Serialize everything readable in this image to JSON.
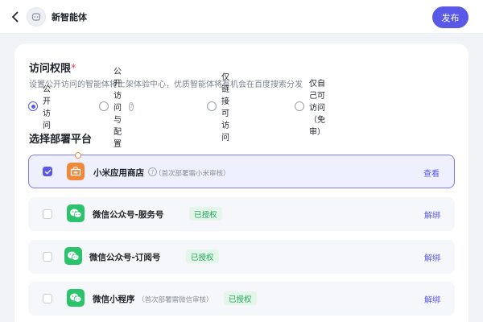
{
  "header": {
    "agent_name": "新智能体",
    "publish_label": "发布"
  },
  "access": {
    "title": "访问权限",
    "required_mark": "*",
    "description": "设置公开访问的智能体将上架体验中心，优质智能体将有机会在百度搜索分发",
    "options": [
      {
        "label": "公开访问",
        "selected": true
      },
      {
        "label": "公开访问与配置",
        "selected": false
      },
      {
        "label": "仅链接可访问",
        "selected": false
      },
      {
        "label": "仅自己可访问（免审）",
        "selected": false
      }
    ]
  },
  "deploy": {
    "title": "选择部署平台",
    "platforms": [
      {
        "name": "小米应用商店",
        "note": "（首次部署需小米审核）",
        "badge": "",
        "action": "查看",
        "checked": true,
        "icon": "xiaomi-store-icon"
      },
      {
        "name": "微信公众号-服务号",
        "note": "",
        "badge": "已授权",
        "action": "解绑",
        "checked": false,
        "icon": "wechat-icon"
      },
      {
        "name": "微信公众号-订阅号",
        "note": "",
        "badge": "已授权",
        "action": "解绑",
        "checked": false,
        "icon": "wechat-icon"
      },
      {
        "name": "微信小程序",
        "note": "（首次部署需微信审核）",
        "badge": "已授权",
        "action": "解绑",
        "checked": false,
        "icon": "wechat-icon"
      }
    ]
  },
  "colors": {
    "accent": "#5a59e7",
    "authorized_bg": "#e4f6e9",
    "authorized_text": "#21a55a",
    "xiaomi_orange": "#ef8a3d",
    "wechat_green": "#2bc36b"
  }
}
